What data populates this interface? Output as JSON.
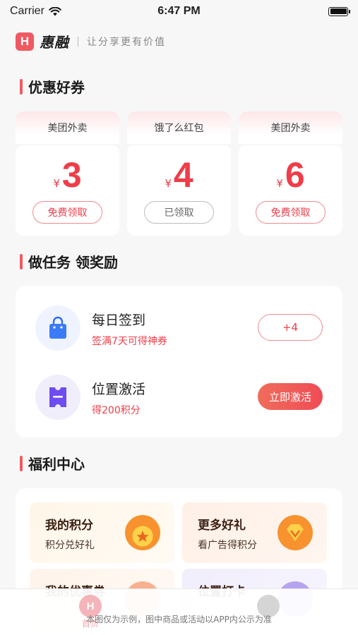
{
  "status_bar": {
    "carrier": "Carrier",
    "time": "6:47 PM"
  },
  "brand": {
    "logo_letter": "H",
    "name": "惠融",
    "slogan": "让分享更有价值"
  },
  "coupons_section": {
    "title": "优惠好券",
    "items": [
      {
        "platform": "美团外卖",
        "currency": "¥",
        "amount": "3",
        "button": "免费领取",
        "state": "available"
      },
      {
        "platform": "饿了么红包",
        "currency": "¥",
        "amount": "4",
        "button": "已领取",
        "state": "claimed"
      },
      {
        "platform": "美团外卖",
        "currency": "¥",
        "amount": "6",
        "button": "免费领取",
        "state": "available"
      }
    ]
  },
  "tasks_section": {
    "title": "做任务 领奖励",
    "items": [
      {
        "name": "每日签到",
        "desc": "签满7天可得神券",
        "action": "+4",
        "icon": "shopping-bag-icon"
      },
      {
        "name": "位置激活",
        "desc": "得200积分",
        "action": "立即激活",
        "icon": "ticket-icon"
      }
    ]
  },
  "welfare_section": {
    "title": "福利中心",
    "items": [
      {
        "title": "我的积分",
        "desc": "积分兑好礼",
        "icon": "star-coin-icon"
      },
      {
        "title": "更多好礼",
        "desc": "看广告得积分",
        "icon": "gem-icon"
      },
      {
        "title": "我的优惠券",
        "desc": "",
        "icon": "coupon-icon"
      },
      {
        "title": "位置打卡",
        "desc": "",
        "icon": "location-icon"
      }
    ]
  },
  "tab_bar": {
    "home_label": "首页",
    "disclaimer": "本图仅为示例，图中商品或活动以APP内公示为准"
  },
  "colors": {
    "accent": "#ef5a62",
    "price": "#ef3d49"
  }
}
